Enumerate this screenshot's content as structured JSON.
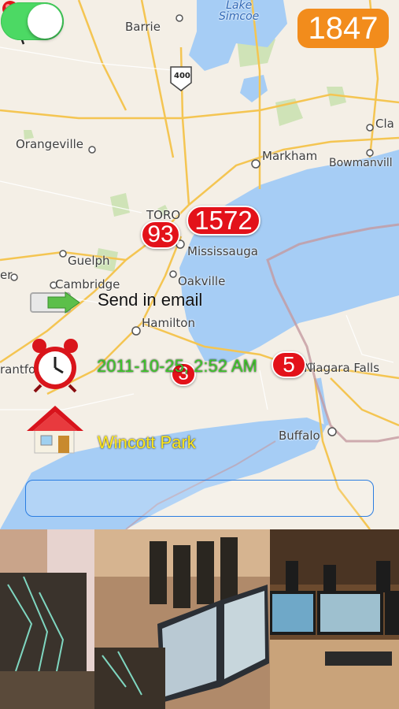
{
  "map": {
    "labels": {
      "barrie": "Barrie",
      "lake_simcoe": "Lake\nSimcoe",
      "highway": "400",
      "orangeville": "Orangeville",
      "markham": "Markham",
      "bowmanville": "Bowmanvill",
      "cla": "Cla",
      "toronto": "TORO",
      "mississauga": "Mississauga",
      "guelph": "Guelph",
      "cambridge": "Cambridge",
      "oakville": "Oakville",
      "hamilton": "Hamilton",
      "brantford": "rantford",
      "niagara": "Niagara Falls",
      "buffalo": "Buffalo",
      "er": "er"
    }
  },
  "toggle": {
    "on": true
  },
  "counter": "1847",
  "badges": {
    "b1572": "1572",
    "b93": "93",
    "b3": "3",
    "b5": "5"
  },
  "actions": {
    "email_label": "Send in email",
    "time_label": "2011-10-25, 2:52 AM",
    "place_label": "Wincott Park"
  },
  "text_field": {
    "value": ""
  },
  "colors": {
    "toggle_on": "#4cd964",
    "counter_bg": "#f28c1c",
    "badge_red": "#e3121a",
    "selection": "#f2911b",
    "water": "#a6cdf5"
  }
}
